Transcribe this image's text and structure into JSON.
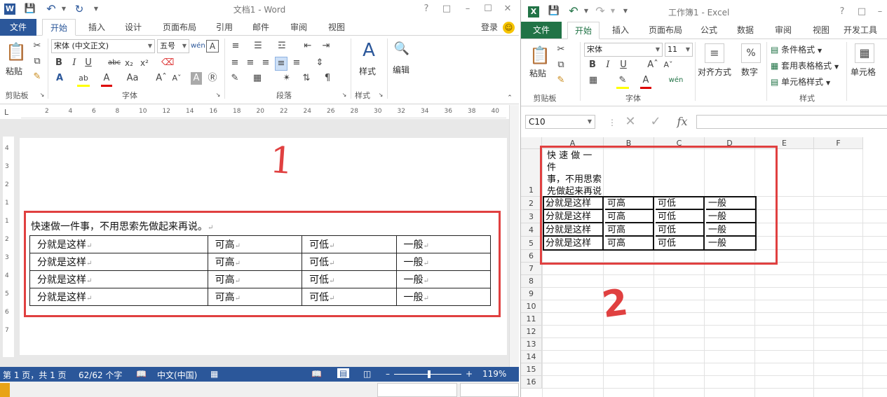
{
  "word": {
    "title": "文档1 - Word",
    "help": "?",
    "tabs": [
      "文件",
      "开始",
      "插入",
      "设计",
      "页面布局",
      "引用",
      "邮件",
      "审阅",
      "视图"
    ],
    "login": "登录",
    "ribbon": {
      "paste": "粘贴",
      "font_name": "宋体 (中文正文)",
      "font_size": "五号",
      "style_label": "样式",
      "edit_label": "编辑",
      "groups": [
        "剪贴板",
        "字体",
        "段落",
        "样式"
      ]
    },
    "ruler_marks": [
      "2",
      "4",
      "6",
      "8",
      "10",
      "12",
      "14",
      "16",
      "18",
      "20",
      "22",
      "24",
      "26",
      "28",
      "30",
      "32",
      "34",
      "36",
      "38",
      "40"
    ],
    "ruler_v_marks": [
      "4",
      "3",
      "2",
      "1",
      "1",
      "2",
      "3",
      "4",
      "5",
      "6",
      "7"
    ],
    "doc_heading": "快速做一件事，不用思索先做起来再说。",
    "table": [
      [
        "分就是这样",
        "可高",
        "可低",
        "一般"
      ],
      [
        "分就是这样",
        "可高",
        "可低",
        "一般"
      ],
      [
        "分就是这样",
        "可高",
        "可低",
        "一般"
      ],
      [
        "分就是这样",
        "可高",
        "可低",
        "一般"
      ]
    ],
    "status": {
      "page": "第 1 页，共 1 页",
      "words": "62/62 个字",
      "lang": "中文(中国)",
      "zoom": "119%"
    },
    "annotation": "1"
  },
  "excel": {
    "title": "工作簿1 - Excel",
    "help": "?",
    "tabs": [
      "文件",
      "开始",
      "插入",
      "页面布局",
      "公式",
      "数据",
      "审阅",
      "视图",
      "开发工具"
    ],
    "ribbon": {
      "paste": "粘贴",
      "font_name": "宋体",
      "font_size": "11",
      "align": "对齐方式",
      "number": "数字",
      "cond_format": "条件格式",
      "table_format": "套用表格格式",
      "cell_style": "单元格样式",
      "cells": "单元格",
      "groups": [
        "剪贴板",
        "字体",
        "样式"
      ]
    },
    "namebox": "C10",
    "columns": [
      "A",
      "B",
      "C",
      "D",
      "E",
      "F"
    ],
    "rows": [
      "1",
      "2",
      "3",
      "4",
      "5",
      "6",
      "7",
      "8",
      "9",
      "10",
      "11",
      "12",
      "13",
      "14",
      "15",
      "16"
    ],
    "a1_text": "快 速 做 一 件 事，不用思索先做起来再说。",
    "a1_lines": [
      "快 速 做 一 件",
      "事，不用思索",
      "先做起来再说",
      "。"
    ],
    "table": [
      [
        "分就是这样",
        "可高",
        "可低",
        "一般"
      ],
      [
        "分就是这样",
        "可高",
        "可低",
        "一般"
      ],
      [
        "分就是这样",
        "可高",
        "可低",
        "一般"
      ],
      [
        "分就是这样",
        "可高",
        "可低",
        "一般"
      ]
    ],
    "annotation": "2"
  },
  "colors": {
    "word_blue": "#2b579a",
    "excel_green": "#217346",
    "annotation_red": "#e04040"
  }
}
